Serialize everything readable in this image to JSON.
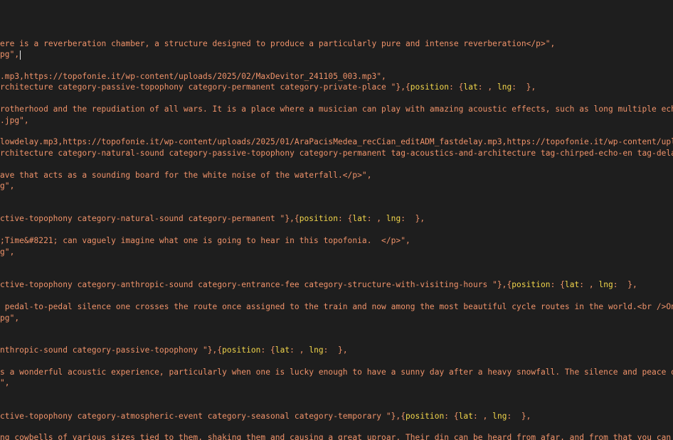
{
  "colors": {
    "background": "#1e1e1e",
    "string_text": "#f0936a",
    "keyword": "#f2d64b"
  },
  "lines": [
    {
      "text": "ere is a reverberation chamber, a structure designed to produce a particularly pure and intense reverberation</p>\","
    },
    {
      "text": "pg\","
    },
    {
      "text": ".mp3,https://topofonie.it/wp-content/uploads/2025/02/MaxDevitor_241105_003.mp3\","
    },
    {
      "pre": "rchitecture category-passive-topophony category-permanent category-private-place \"},{",
      "k1": "position",
      "m1": ": {",
      "k2": "lat",
      "m2": ": , ",
      "k3": "lng",
      "post": ":  },"
    },
    {
      "text": "rotherhood and the repudiation of all wars. It is a place where a musician can play with amazing acoustic effects, such as long multiple echoes"
    },
    {
      "text": ".jpg\","
    },
    {
      "text": "lowdelay.mp3,https://topofonie.it/wp-content/uploads/2025/01/AraPacisMedea_recCian_editADM_fastdelay.mp3,https://topofonie.it/wp-content/upload"
    },
    {
      "text": "rchitecture category-natural-sound category-passive-topophony category-permanent tag-acoustics-and-architecture tag-chirped-echo-en tag-delay-e"
    },
    {
      "text": "ave that acts as a sounding board for the white noise of the waterfall.</p>\","
    },
    {
      "text": "g\","
    },
    {
      "pre": "ctive-topophony category-natural-sound category-permanent \"},{",
      "k1": "position",
      "m1": ": {",
      "k2": "lat",
      "m2": ": , ",
      "k3": "lng",
      "post": ":  },"
    },
    {
      "text": ";Time&#8221; can vaguely imagine what one is going to hear in this topofonia.  </p>\","
    },
    {
      "text": "g\","
    },
    {
      "pre": "ctive-topophony category-anthropic-sound category-entrance-fee category-structure-with-visiting-hours \"},{",
      "k1": "position",
      "m1": ": {",
      "k2": "lat",
      "m2": ": , ",
      "k3": "lng",
      "post": ":  },"
    },
    {
      "text": " pedal-to-pedal silence one crosses the route once assigned to the train and now among the most beautiful cycle routes in the world.<br />On th"
    },
    {
      "text": "pg\","
    },
    {
      "pre": "nthropic-sound category-passive-topophony \"},{",
      "k1": "position",
      "m1": ": {",
      "k2": "lat",
      "m2": ": , ",
      "k3": "lng",
      "post": ":  },"
    },
    {
      "text": "s a wonderful acoustic experience, particularly when one is lucky enough to have a sunny day after a heavy snowfall. The silence and peace of t"
    },
    {
      "text": "\","
    },
    {
      "pre": "ctive-topophony category-atmospheric-event category-seasonal category-temporary \"},{",
      "k1": "position",
      "m1": ": {",
      "k2": "lat",
      "m2": ": , ",
      "k3": "lng",
      "post": ":  },"
    },
    {
      "text": "ng cowbells of various sizes tied to them, shaking them and causing a great uproar. Their din can be heard from afar, and from that you can tel"
    }
  ]
}
